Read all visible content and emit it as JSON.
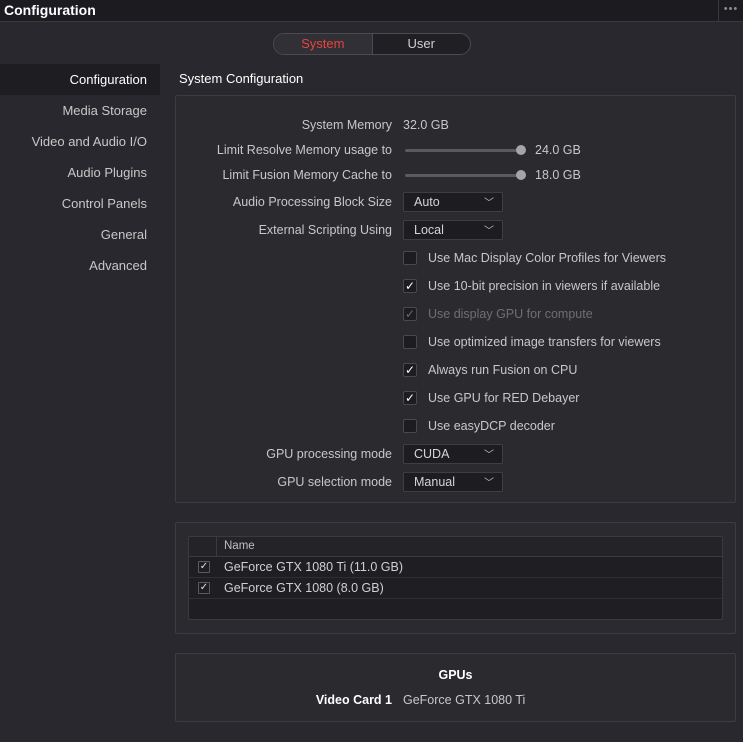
{
  "window": {
    "title": "Configuration"
  },
  "tabs": [
    {
      "label": "System",
      "active": true
    },
    {
      "label": "User",
      "active": false
    }
  ],
  "sidebar": {
    "items": [
      {
        "label": "Configuration",
        "active": true
      },
      {
        "label": "Media Storage"
      },
      {
        "label": "Video and Audio I/O"
      },
      {
        "label": "Audio Plugins"
      },
      {
        "label": "Control Panels"
      },
      {
        "label": "General"
      },
      {
        "label": "Advanced"
      }
    ]
  },
  "system_config": {
    "title": "System Configuration",
    "system_memory": {
      "label": "System Memory",
      "value": "32.0 GB"
    },
    "limit_resolve": {
      "label": "Limit Resolve Memory usage to",
      "value": "24.0 GB",
      "fraction": 1.0
    },
    "limit_fusion": {
      "label": "Limit Fusion Memory Cache to",
      "value": "18.0 GB",
      "fraction": 1.0
    },
    "audio_block": {
      "label": "Audio Processing Block Size",
      "value": "Auto"
    },
    "scripting": {
      "label": "External Scripting Using",
      "value": "Local"
    },
    "checkboxes": [
      {
        "label": "Use Mac Display Color Profiles for Viewers",
        "checked": false,
        "disabled": false
      },
      {
        "label": "Use 10-bit precision in viewers if available",
        "checked": true,
        "disabled": false
      },
      {
        "label": "Use display GPU for compute",
        "checked": true,
        "disabled": true
      },
      {
        "label": "Use optimized image transfers for viewers",
        "checked": false,
        "disabled": false
      },
      {
        "label": "Always run Fusion on CPU",
        "checked": true,
        "disabled": false
      },
      {
        "label": "Use GPU for RED Debayer",
        "checked": true,
        "disabled": false
      },
      {
        "label": "Use easyDCP decoder",
        "checked": false,
        "disabled": false
      }
    ],
    "gpu_mode": {
      "label": "GPU processing mode",
      "value": "CUDA"
    },
    "gpu_selection": {
      "label": "GPU selection mode",
      "value": "Manual"
    }
  },
  "gpu_table": {
    "column": "Name",
    "rows": [
      {
        "name": "GeForce GTX 1080 Ti (11.0 GB)",
        "checked": true
      },
      {
        "name": "GeForce GTX 1080 (8.0 GB)",
        "checked": true
      }
    ]
  },
  "gpus_panel": {
    "title": "GPUs",
    "video_card_label": "Video Card 1",
    "video_card_value": "GeForce GTX 1080 Ti"
  },
  "icons": {
    "check": "✓",
    "chevron": "chevron-down-icon",
    "menu": "more-dots-icon"
  },
  "colors": {
    "accent": "#e9443e",
    "background": "#28282e"
  }
}
